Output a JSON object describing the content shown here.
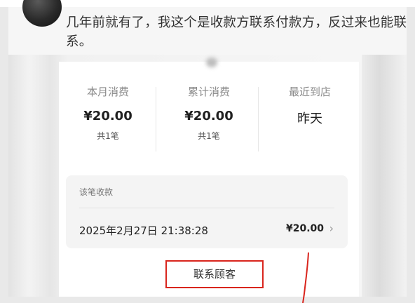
{
  "comment": {
    "text": "几年前就有了，我这个是收款方联系付款方，反过来也能联系。"
  },
  "stats": [
    {
      "label": "本月消费",
      "value": "¥20.00",
      "sub": "共1笔"
    },
    {
      "label": "累计消费",
      "value": "¥20.00",
      "sub": "共1笔"
    },
    {
      "label": "最近到店",
      "value": "昨天",
      "sub": ""
    }
  ],
  "transaction": {
    "header": "该笔收款",
    "datetime": "2025年2月27日 21:38:28",
    "amount": "¥20.00"
  },
  "contact_button": {
    "label": "联系顾客"
  },
  "colors": {
    "highlight_red": "#d9251d"
  }
}
